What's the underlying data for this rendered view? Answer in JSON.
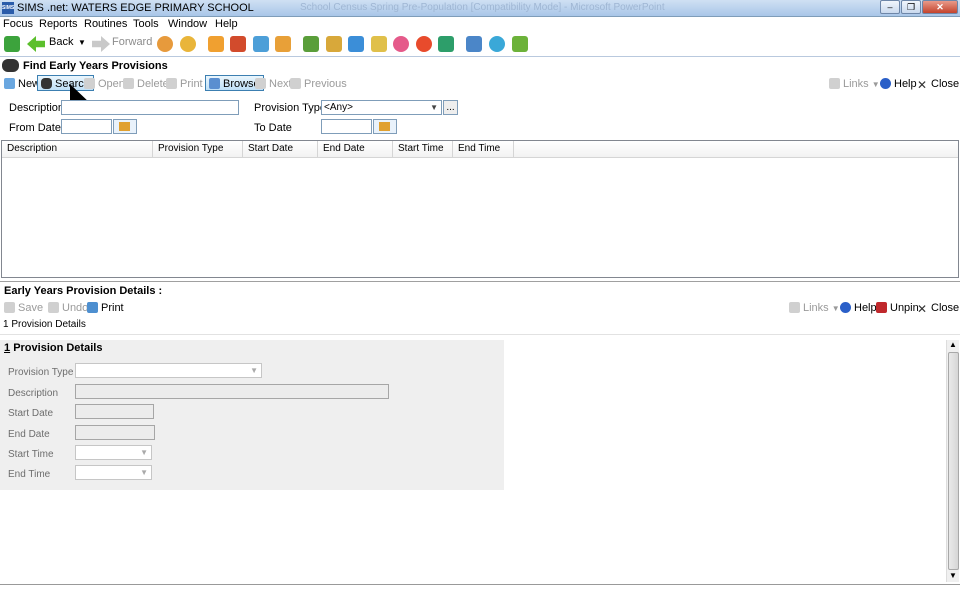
{
  "window": {
    "title": "SIMS .net: WATERS EDGE PRIMARY SCHOOL",
    "ghost_title": "School Census Spring Pre-Population [Compatibility Mode] - Microsoft PowerPoint"
  },
  "menu": [
    {
      "label": "Focus"
    },
    {
      "label": "Reports"
    },
    {
      "label": "Routines"
    },
    {
      "label": "Tools"
    },
    {
      "label": "Window"
    },
    {
      "label": "Help"
    }
  ],
  "nav": {
    "back_label": "Back",
    "forward_label": "Forward"
  },
  "find": {
    "title": "Find Early Years Provisions",
    "toolbar": {
      "new": "New",
      "search": "Search",
      "open": "Open",
      "delete": "Delete",
      "print": "Print",
      "browse": "Browse",
      "next": "Next",
      "previous": "Previous",
      "links": "Links",
      "help": "Help",
      "close": "Close"
    },
    "fields": {
      "description_label": "Description",
      "description_value": "",
      "provision_type_label": "Provision Type",
      "provision_type_value": "<Any>",
      "from_date_label": "From Date",
      "to_date_label": "To Date",
      "ellipsis": "..."
    },
    "columns": [
      "Description",
      "Provision Type",
      "Start Date",
      "End Date",
      "Start Time",
      "End Time"
    ]
  },
  "details": {
    "title": "Early Years Provision Details :",
    "toolbar": {
      "save": "Save",
      "undo": "Undo",
      "print": "Print",
      "links": "Links",
      "help": "Help",
      "unpin": "Unpin",
      "close": "Close"
    },
    "breadcrumb": "1 Provision Details",
    "section": {
      "number": "1",
      "title": "Provision Details"
    },
    "fields": {
      "provision_type": "Provision Type",
      "description": "Description",
      "start_date": "Start Date",
      "end_date": "End Date",
      "start_time": "Start Time",
      "end_time": "End Time"
    }
  }
}
